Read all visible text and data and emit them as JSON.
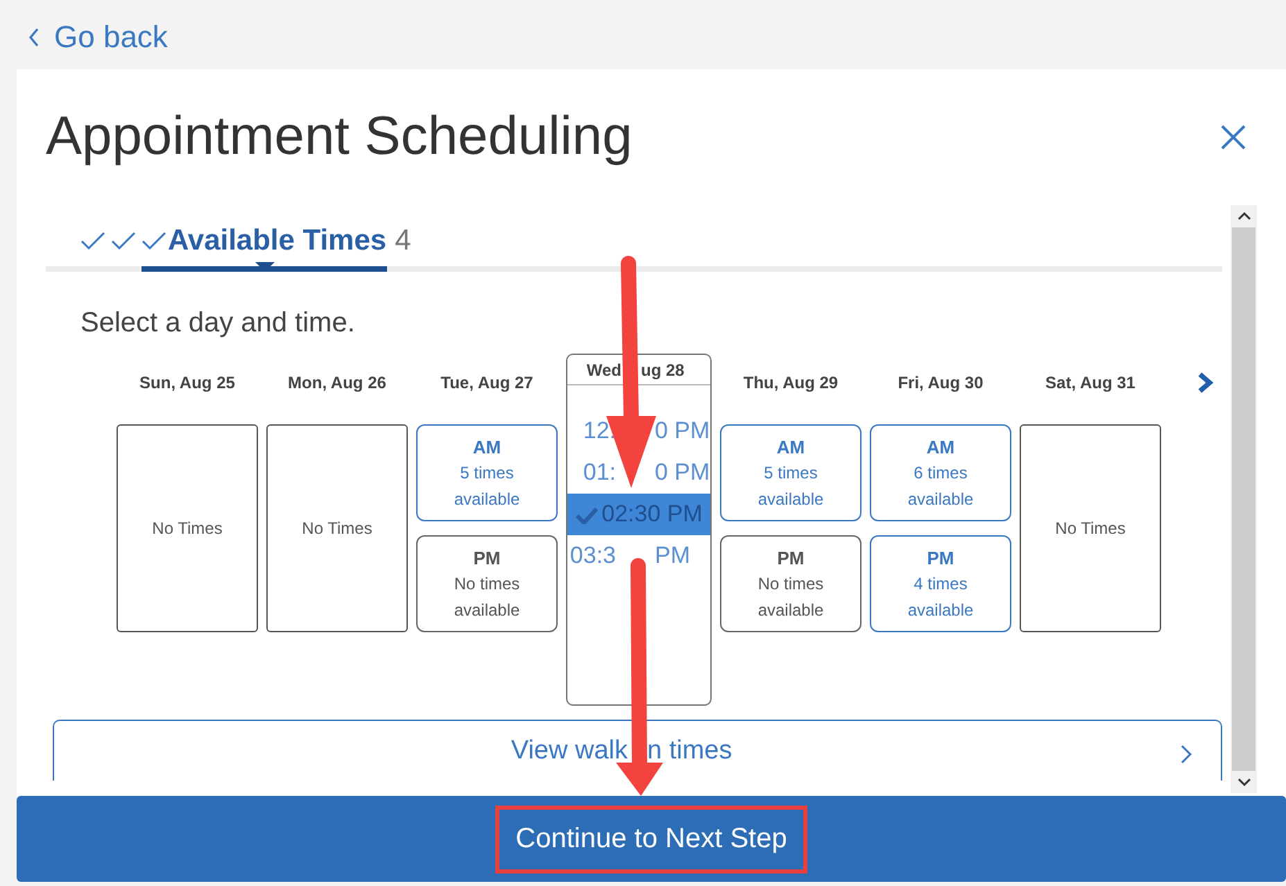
{
  "back_link": "Go back",
  "dialog": {
    "title": "Appointment Scheduling",
    "steps": [
      {
        "kind": "done"
      },
      {
        "kind": "done"
      },
      {
        "kind": "current",
        "label": "Available Times",
        "selected": true
      },
      {
        "kind": "next",
        "label": "4",
        "selected": false
      }
    ],
    "instruction": "Select a day and time.",
    "days": [
      {
        "label": [
          "Sun, Aug 25"
        ],
        "kind": "none",
        "text": "No Times",
        "selected": false
      },
      {
        "label": [
          "Mon, Aug 26"
        ],
        "kind": "none",
        "text": "No Times",
        "selected": false
      },
      {
        "label": [
          "Tue, Aug 27"
        ],
        "kind": "split",
        "selected": false,
        "slots": [
          {
            "period": "AM",
            "lines": [
              "5 times",
              "available"
            ],
            "available": true
          },
          {
            "period": "PM",
            "lines": [
              "No times",
              "available"
            ],
            "available": false
          }
        ]
      },
      {
        "label": [
          "Wed",
          "ug 28"
        ],
        "kind": "list",
        "selected": true,
        "times": [
          {
            "time": [
              "12:",
              "0 PM"
            ],
            "selected": false
          },
          {
            "time": [
              "01:",
              "0 PM"
            ],
            "selected": false
          },
          {
            "time": [
              "02:30 PM"
            ],
            "selected": true
          },
          {
            "time": [
              "03:3",
              "PM"
            ],
            "selected": false
          }
        ]
      },
      {
        "label": [
          "Thu, Aug 29"
        ],
        "kind": "split",
        "selected": false,
        "slots": [
          {
            "period": "AM",
            "lines": [
              "5 times",
              "available"
            ],
            "available": true
          },
          {
            "period": "PM",
            "lines": [
              "No times",
              "available"
            ],
            "available": false
          }
        ]
      },
      {
        "label": [
          "Fri, Aug 30"
        ],
        "kind": "split",
        "selected": false,
        "slots": [
          {
            "period": "AM",
            "lines": [
              "6 times",
              "available"
            ],
            "available": true
          },
          {
            "period": "PM",
            "lines": [
              "4 times",
              "available"
            ],
            "available": true
          }
        ]
      },
      {
        "label": [
          "Sat, Aug 31"
        ],
        "kind": "none",
        "text": "No Times",
        "selected": false
      }
    ],
    "walk_in": [
      "View walk",
      "n times"
    ],
    "continue": {
      "label": "Continue to Next Step",
      "highlighted": true
    }
  },
  "annotations": [
    {
      "kind": "arrow"
    },
    {
      "kind": "arrow"
    }
  ]
}
